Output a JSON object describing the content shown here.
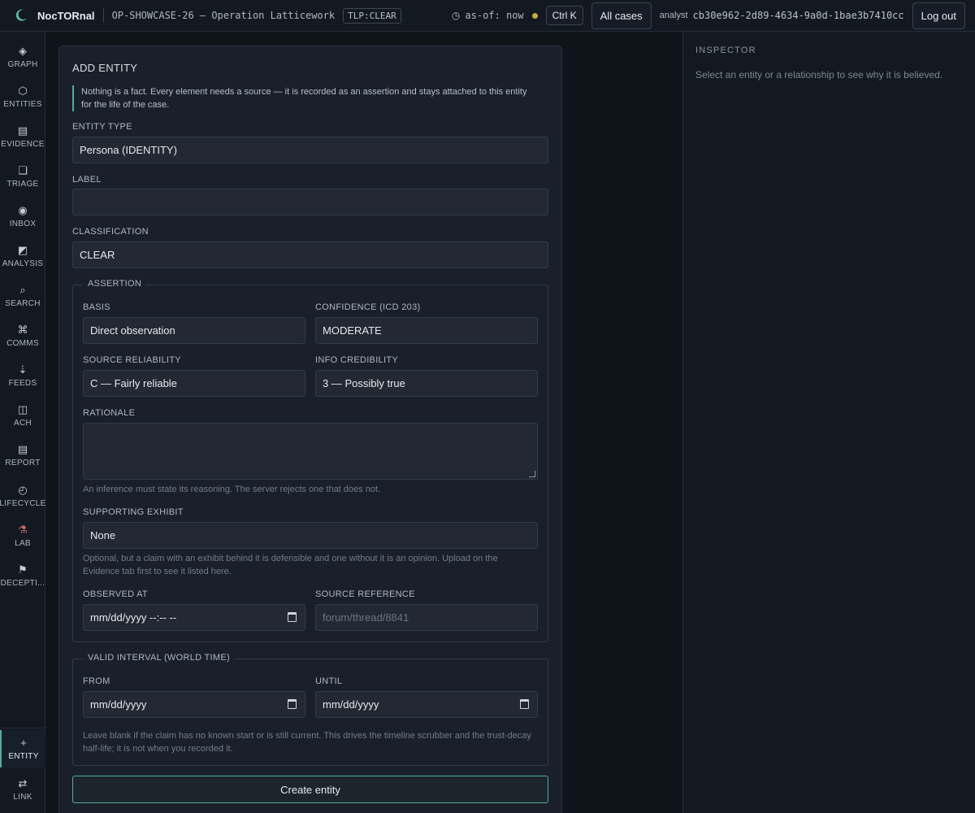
{
  "topbar": {
    "brand": "NocTORnal",
    "case_title": "OP-SHOWCASE-26 — Operation Latticework",
    "tlp": "TLP:CLEAR",
    "as_of": "as-of: now",
    "shortcut": "Ctrl K",
    "all_cases": "All cases",
    "analyst_label": "analyst",
    "analyst_id": "cb30e962-2d89-4634-9a0d-1bae3b7410cc",
    "logout": "Log out",
    "status_color": "#c9a84a"
  },
  "nav": {
    "items": [
      {
        "label": "GRAPH",
        "icon": "◈"
      },
      {
        "label": "ENTITIES",
        "icon": "⬡"
      },
      {
        "label": "EVIDENCE",
        "icon": "▤"
      },
      {
        "label": "TRIAGE",
        "icon": "❏"
      },
      {
        "label": "INBOX",
        "icon": "◉"
      },
      {
        "label": "ANALYSIS",
        "icon": "◩"
      },
      {
        "label": "SEARCH",
        "icon": "⌕"
      },
      {
        "label": "COMMS",
        "icon": "⌘"
      },
      {
        "label": "FEEDS",
        "icon": "⇣"
      },
      {
        "label": "ACH",
        "icon": "◫"
      },
      {
        "label": "REPORT",
        "icon": "▤"
      },
      {
        "label": "LIFECYCLE",
        "icon": "◴"
      },
      {
        "label": "LAB",
        "icon": "⚗"
      },
      {
        "label": "DECEPTI...",
        "icon": "⚑"
      }
    ],
    "bottom": [
      {
        "label": "ENTITY",
        "icon": "+"
      },
      {
        "label": "LINK",
        "icon": "⇄"
      }
    ]
  },
  "form": {
    "title": "ADD ENTITY",
    "notice": "Nothing is a fact. Every element needs a source — it is recorded as an assertion and stays attached to this entity for the life of the case.",
    "entity_type_label": "ENTITY TYPE",
    "entity_type_value": "Persona (IDENTITY)",
    "label_label": "LABEL",
    "label_value": "",
    "classification_label": "CLASSIFICATION",
    "classification_value": "CLEAR",
    "assertion": {
      "legend": "ASSERTION",
      "basis_label": "BASIS",
      "basis_value": "Direct observation",
      "confidence_label": "CONFIDENCE (ICD 203)",
      "confidence_value": "MODERATE",
      "reliability_label": "SOURCE RELIABILITY",
      "reliability_value": "C — Fairly reliable",
      "credibility_label": "INFO CREDIBILITY",
      "credibility_value": "3 — Possibly true",
      "rationale_label": "RATIONALE",
      "rationale_hint": "An inference must state its reasoning. The server rejects one that does not.",
      "exhibit_label": "SUPPORTING EXHIBIT",
      "exhibit_value": "None",
      "exhibit_hint_1": "Optional, but a claim with an exhibit behind it is defensible and one without it is an opinion. Upload on the",
      "exhibit_hint_2": "Evidence tab first to see it listed here.",
      "observed_label": "OBSERVED AT",
      "observed_value": "mm/dd/yyyy --:-- --",
      "source_ref_label": "SOURCE REFERENCE",
      "source_ref_placeholder": "forum/thread/8841"
    },
    "interval": {
      "legend": "VALID INTERVAL (WORLD TIME)",
      "from_label": "FROM",
      "from_value": "mm/dd/yyyy",
      "until_label": "UNTIL",
      "until_value": "mm/dd/yyyy",
      "hint_1": "Leave blank if the claim has no known start or is still current. This drives the timeline scrubber and the trust-decay",
      "hint_2": "half-life; it is not when you recorded it."
    },
    "submit": "Create entity",
    "accent_color": "#4fae9c"
  },
  "inspector": {
    "title": "INSPECTOR",
    "hint": "Select an entity or a relationship to see why it is believed."
  }
}
